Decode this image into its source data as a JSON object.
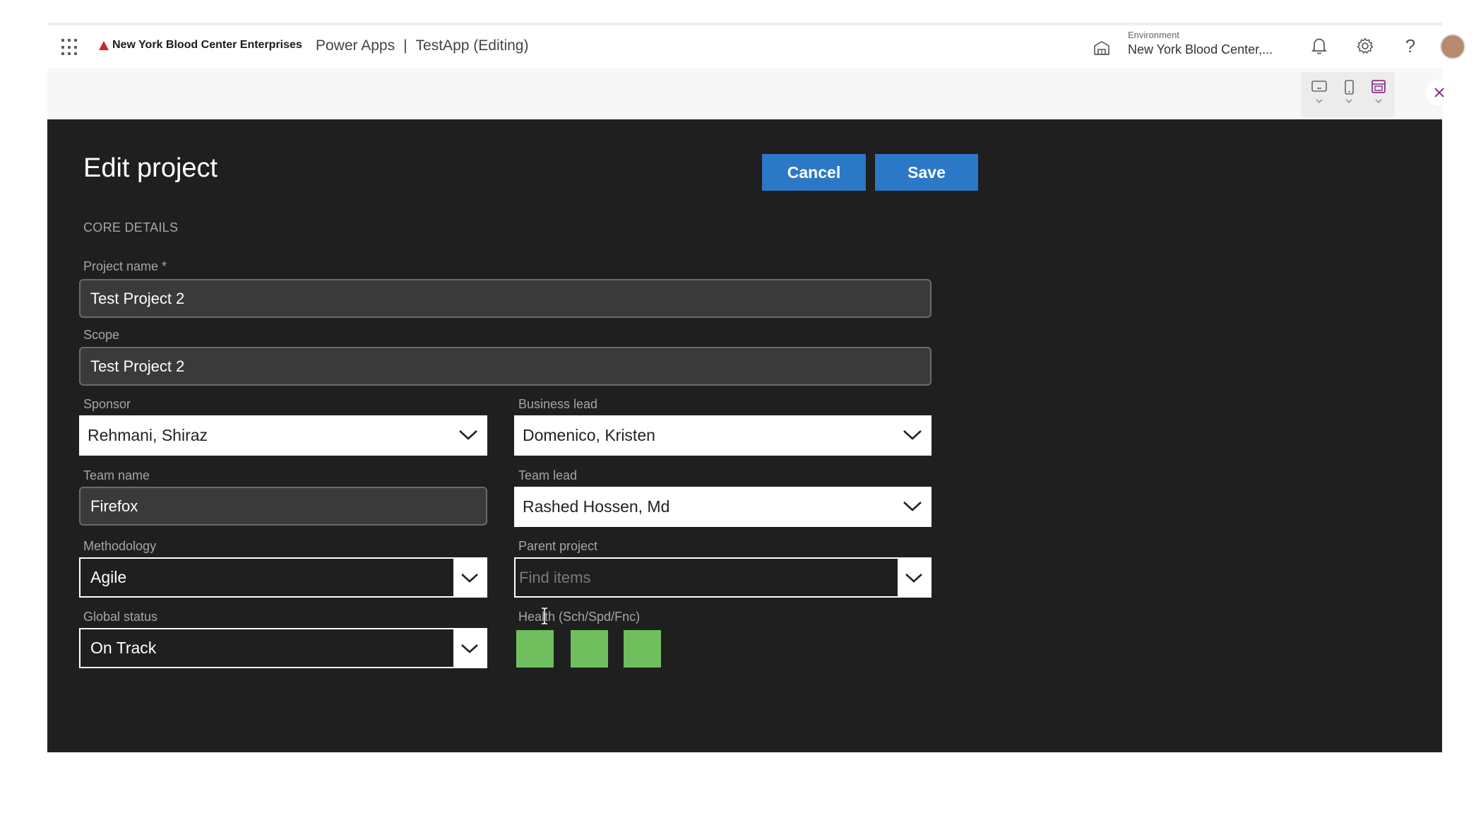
{
  "header": {
    "brand": "New York Blood Center Enterprises",
    "app_name": "Power Apps",
    "separator": "|",
    "app_title": "TestApp (Editing)",
    "environment_label": "Environment",
    "environment_value": "New York Blood Center,..."
  },
  "icons": {
    "waffle": "app-launcher-icon",
    "environment": "building-icon",
    "notifications": "bell-icon",
    "settings": "gear-icon",
    "help": "question-icon",
    "close": "close-icon"
  },
  "form": {
    "title": "Edit project",
    "cancel_label": "Cancel",
    "save_label": "Save",
    "section_core": "CORE DETAILS",
    "project_name_label": "Project name *",
    "project_name_value": "Test Project 2",
    "scope_label": "Scope",
    "scope_value": "Test Project 2",
    "sponsor_label": "Sponsor",
    "sponsor_value": "Rehmani, Shiraz",
    "business_lead_label": "Business lead",
    "business_lead_value": "Domenico, Kristen",
    "team_name_label": "Team name",
    "team_name_value": "Firefox",
    "team_lead_label": "Team lead",
    "team_lead_value": "Rashed Hossen, Md",
    "methodology_label": "Methodology",
    "methodology_value": "Agile",
    "parent_project_label": "Parent project",
    "parent_project_placeholder": "Find items",
    "global_status_label": "Global status",
    "global_status_value": "On Track",
    "health_label": "Health (Sch/Spd/Fnc)",
    "health_colors": [
      "#6fbf5e",
      "#6fbf5e",
      "#6fbf5e"
    ]
  },
  "colors": {
    "accent": "#2b78c6",
    "canvas": "#1f1f1f",
    "brand_red": "#d1232a",
    "health_green": "#6fbf5e"
  }
}
